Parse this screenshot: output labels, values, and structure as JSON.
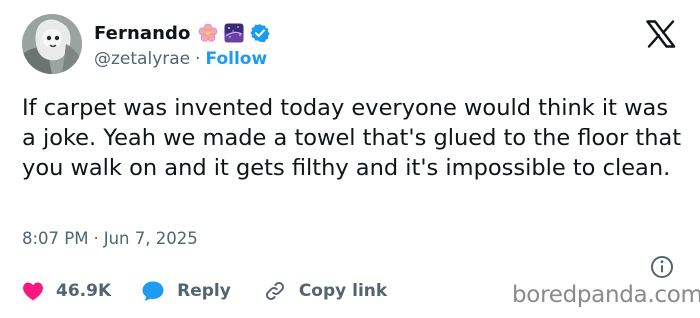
{
  "author": {
    "display_name": "Fernando",
    "handle": "@zetalyrae",
    "follow_label": "Follow",
    "separator": "·",
    "badges": [
      "cherry-blossom-emoji",
      "galaxy-emoji",
      "verified-badge"
    ]
  },
  "tweet": {
    "text": "If carpet was invented today everyone would think it was  a joke. Yeah we made a towel that's glued to the floor that you walk on and it gets filthy and it's impossible to clean.",
    "time": "8:07 PM",
    "separator": "·",
    "date": "Jun 7, 2025"
  },
  "actions": {
    "likes_count": "46.9K",
    "reply_label": "Reply",
    "copy_link_label": "Copy link"
  },
  "watermark": "boredpanda.com",
  "colors": {
    "accent": "#1d9bf0",
    "like": "#f91880",
    "secondary_text": "#536471",
    "text": "#0f1419"
  }
}
